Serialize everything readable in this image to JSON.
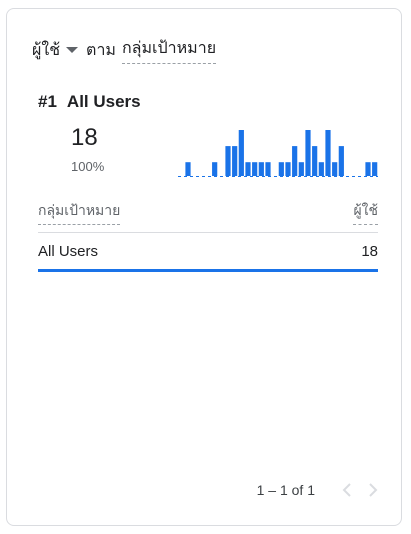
{
  "header": {
    "metric_label": "ผู้ใช้",
    "by_label": "ตาม",
    "dimension_label": "กลุ่มเป้าหมาย"
  },
  "top": {
    "rank": "#1",
    "name": "All Users",
    "value": "18",
    "percent": "100%"
  },
  "table": {
    "dimension_header": "กลุ่มเป้าหมาย",
    "metric_header": "ผู้ใช้",
    "rows": [
      {
        "name": "All Users",
        "value": "18",
        "share": 1.0
      }
    ]
  },
  "pagination": {
    "range": "1 – 1 of 1",
    "prev_icon": "chevron-left-icon",
    "next_icon": "chevron-right-icon"
  },
  "colors": {
    "accent": "#1a73e8",
    "text": "#202124",
    "muted": "#5f6368",
    "divider": "#dadce0"
  },
  "chart_data": {
    "type": "bar",
    "series": [
      {
        "values": [
          0,
          0.3,
          0,
          0,
          0,
          0.3,
          0,
          0.65,
          0.65,
          1.0,
          0.3,
          0.3,
          0.3,
          0.3,
          0,
          0.3,
          0.3,
          0.65,
          0.3,
          1.0,
          0.65,
          0.3,
          1.0,
          0.3,
          0.65,
          0,
          0,
          0,
          0.3,
          0.3
        ]
      }
    ]
  }
}
